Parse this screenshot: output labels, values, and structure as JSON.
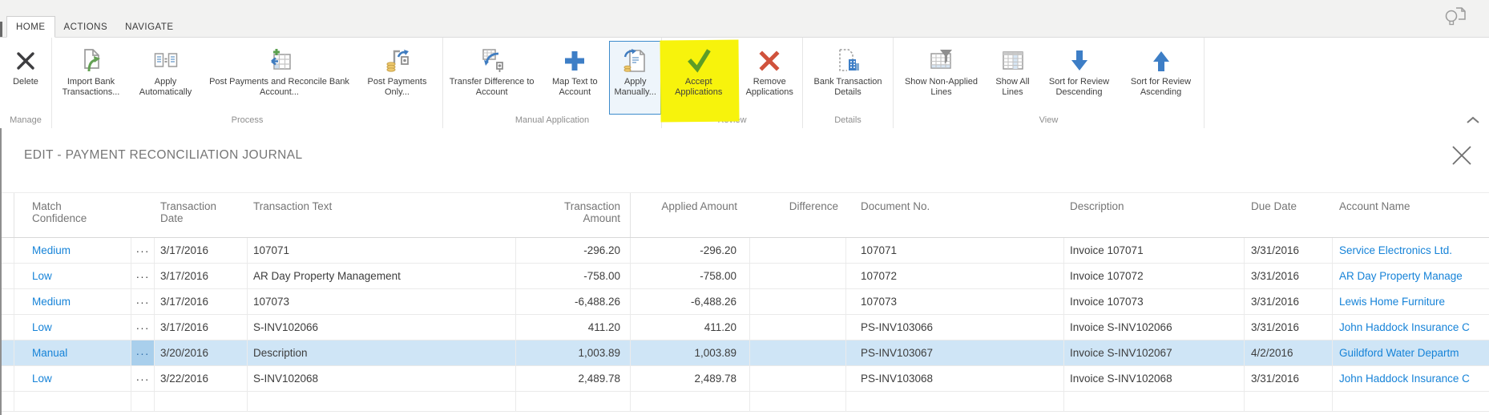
{
  "colors": {
    "accent_blue": "#1683d8",
    "selected_row": "#cfe5f6",
    "highlight_yellow": "#f7f30c",
    "accept_green": "#5c9d27",
    "remove_red": "#d0523c"
  },
  "ribbon": {
    "tabs": [
      "HOME",
      "ACTIONS",
      "NAVIGATE"
    ],
    "active_tab": "HOME",
    "groups": [
      {
        "label": "Manage",
        "buttons": [
          {
            "label": "Delete",
            "icon": "delete-icon"
          }
        ]
      },
      {
        "label": "Process",
        "buttons": [
          {
            "label": "Import Bank Transactions...",
            "icon": "import-bank-transactions-icon"
          },
          {
            "label": "Apply Automatically",
            "icon": "apply-automatically-icon"
          },
          {
            "label": "Post Payments and Reconcile Bank Account...",
            "icon": "post-payments-reconcile-icon"
          },
          {
            "label": "Post Payments Only...",
            "icon": "post-payments-only-icon"
          }
        ]
      },
      {
        "label": "Manual Application",
        "buttons": [
          {
            "label": "Transfer Difference to Account",
            "icon": "transfer-difference-icon"
          },
          {
            "label": "Map Text to Account",
            "icon": "map-text-to-account-icon"
          },
          {
            "label": "Apply Manually...",
            "icon": "apply-manually-icon",
            "selected": true
          }
        ]
      },
      {
        "label": "Review",
        "buttons": [
          {
            "label": "Accept Applications",
            "icon": "accept-applications-icon",
            "highlighted": true
          },
          {
            "label": "Remove Applications",
            "icon": "remove-applications-icon"
          }
        ]
      },
      {
        "label": "Details",
        "buttons": [
          {
            "label": "Bank Transaction Details",
            "icon": "bank-transaction-details-icon"
          }
        ]
      },
      {
        "label": "View",
        "buttons": [
          {
            "label": "Show Non-Applied Lines",
            "icon": "show-non-applied-lines-icon"
          },
          {
            "label": "Show All Lines",
            "icon": "show-all-lines-icon"
          },
          {
            "label": "Sort for Review Descending",
            "icon": "sort-descending-icon"
          },
          {
            "label": "Sort for Review Ascending",
            "icon": "sort-ascending-icon"
          }
        ]
      }
    ]
  },
  "page": {
    "title": "EDIT - PAYMENT RECONCILIATION JOURNAL"
  },
  "table": {
    "ellipsis": "···",
    "columns": {
      "match": "Match Confidence",
      "date": "Transaction Date",
      "text": "Transaction Text",
      "amount": "Transaction Amount",
      "applied": "Applied Amount",
      "difference": "Difference",
      "document": "Document No.",
      "description": "Description",
      "due": "Due Date",
      "account": "Account Name"
    },
    "rows": [
      {
        "confidence": "Medium",
        "date": "3/17/2016",
        "text": "107071",
        "amount": "-296.20",
        "applied": "-296.20",
        "difference": "",
        "document": "107071",
        "description": "Invoice 107071",
        "due": "3/31/2016",
        "account": "Service Electronics Ltd.",
        "selected": false
      },
      {
        "confidence": "Low",
        "date": "3/17/2016",
        "text": "AR Day Property Management",
        "amount": "-758.00",
        "applied": "-758.00",
        "difference": "",
        "document": "107072",
        "description": "Invoice 107072",
        "due": "3/31/2016",
        "account": "AR Day Property Manage",
        "selected": false
      },
      {
        "confidence": "Medium",
        "date": "3/17/2016",
        "text": "107073",
        "amount": "-6,488.26",
        "applied": "-6,488.26",
        "difference": "",
        "document": "107073",
        "description": "Invoice 107073",
        "due": "3/31/2016",
        "account": "Lewis Home Furniture",
        "selected": false
      },
      {
        "confidence": "Low",
        "date": "3/17/2016",
        "text": "S-INV102066",
        "amount": "411.20",
        "applied": "411.20",
        "difference": "",
        "document": "PS-INV103066",
        "description": "Invoice S-INV102066",
        "due": "3/31/2016",
        "account": "John Haddock Insurance C",
        "selected": false
      },
      {
        "confidence": "Manual",
        "date": "3/20/2016",
        "text": "Description",
        "amount": "1,003.89",
        "applied": "1,003.89",
        "difference": "",
        "document": "PS-INV103067",
        "description": "Invoice S-INV102067",
        "due": "4/2/2016",
        "account": "Guildford Water Departm",
        "selected": true
      },
      {
        "confidence": "Low",
        "date": "3/22/2016",
        "text": "S-INV102068",
        "amount": "2,489.78",
        "applied": "2,489.78",
        "difference": "",
        "document": "PS-INV103068",
        "description": "Invoice S-INV102068",
        "due": "3/31/2016",
        "account": "John Haddock Insurance C",
        "selected": false
      }
    ]
  }
}
